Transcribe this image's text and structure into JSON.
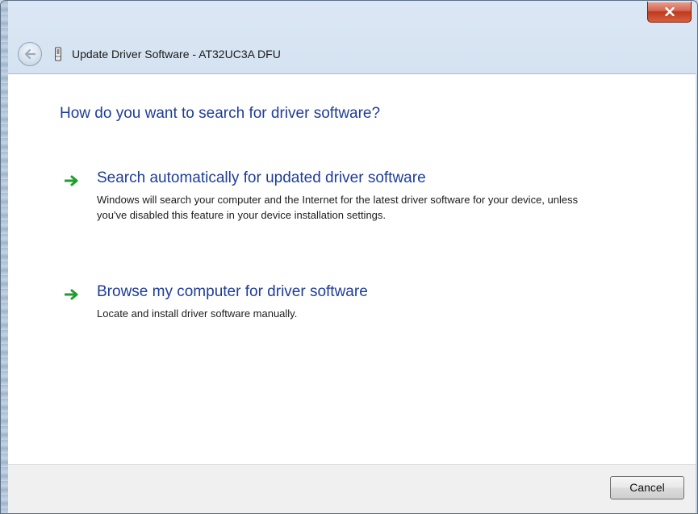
{
  "window": {
    "title": "Update Driver Software - AT32UC3A DFU",
    "close_label": "x"
  },
  "content": {
    "heading": "How do you want to search for driver software?",
    "options": [
      {
        "title": "Search automatically for updated driver software",
        "description": "Windows will search your computer and the Internet for the latest driver software for your device, unless you've disabled this feature in your device installation settings.",
        "icon": "green-arrow-icon"
      },
      {
        "title": "Browse my computer for driver software",
        "description": "Locate and install driver software manually.",
        "icon": "green-arrow-icon"
      }
    ]
  },
  "footer": {
    "cancel_label": "Cancel"
  },
  "colors": {
    "link_blue": "#1f3d95",
    "arrow_green": "#1e9e2c",
    "close_red": "#c0391d"
  },
  "icons": {
    "back": "back-arrow-icon",
    "device": "usb-device-icon",
    "close": "close-icon"
  }
}
